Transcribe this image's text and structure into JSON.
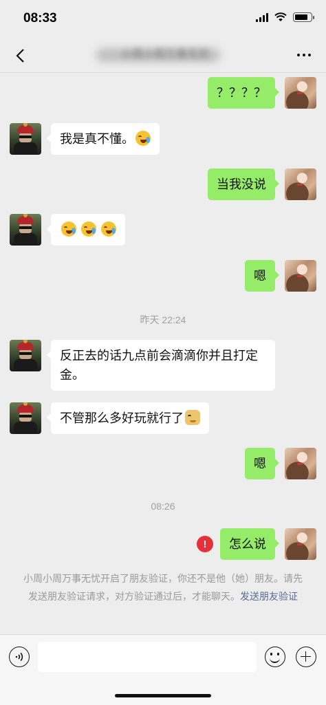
{
  "status_bar": {
    "time": "08:33",
    "battery_level": 0.8
  },
  "nav": {
    "title": "小周小周万事无忧",
    "back_icon": "chevron-left-icon",
    "more_icon": "more-dots-icon"
  },
  "messages": [
    {
      "side": "right",
      "text": "？？？？"
    },
    {
      "side": "left",
      "text": "我是真不懂。",
      "emoji": "laugh-cry-icon"
    },
    {
      "side": "right",
      "text": "当我没说"
    },
    {
      "side": "left",
      "text": "",
      "emoji_count": 3
    },
    {
      "side": "right",
      "text": "嗯"
    },
    {
      "side": "left",
      "text": "反正去的话九点前会滴滴你并且打定金。"
    },
    {
      "side": "left",
      "text": "不管那么多好玩就行了",
      "emoji": "doge-icon"
    },
    {
      "side": "right",
      "text": "嗯"
    },
    {
      "side": "right",
      "text": "怎么说",
      "failed": true
    }
  ],
  "timestamps": [
    "昨天 22:24",
    "08:26"
  ],
  "system_notice": {
    "text": "小周小周万事无忧开启了朋友验证，你还不是他（她）朋友。请先发送朋友验证请求，对方验证通过后，才能聊天。",
    "link": "发送朋友验证"
  },
  "input_bar": {
    "value": "",
    "voice_icon": "voice-icon",
    "emoji_icon": "emoji-icon",
    "plus_icon": "plus-icon"
  },
  "colors": {
    "background": "#ededed",
    "my_bubble": "#95ec69",
    "other_bubble": "#ffffff",
    "link": "#576b95",
    "error": "#e7303b"
  }
}
